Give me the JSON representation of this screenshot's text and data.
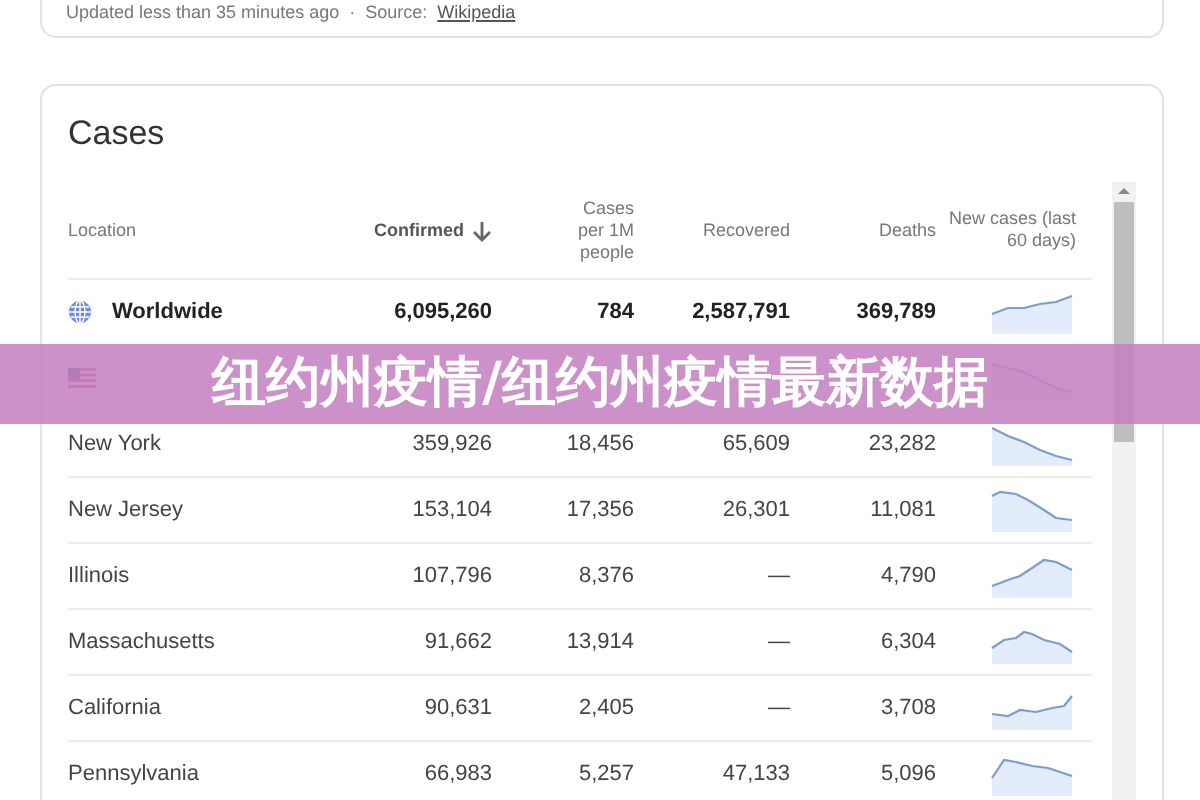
{
  "top_card": {
    "updated": "Updated less than 35 minutes ago",
    "separator": "·",
    "source_label": "Source:",
    "source_link": "Wikipedia"
  },
  "cases": {
    "title": "Cases",
    "columns": [
      {
        "label": "Location",
        "sorted": false
      },
      {
        "label": "Confirmed",
        "sorted": true
      },
      {
        "label": "Cases per 1M people",
        "sorted": false
      },
      {
        "label": "Recovered",
        "sorted": false
      },
      {
        "label": "Deaths",
        "sorted": false
      },
      {
        "label": "New cases (last 60 days)",
        "sorted": false
      }
    ],
    "rows": [
      {
        "kind": "globe",
        "location": "Worldwide",
        "confirmed": "6,095,260",
        "per_million": "784",
        "recovered": "2,587,791",
        "deaths": "369,789"
      },
      {
        "kind": "flag"
      },
      {
        "kind": "plain",
        "location": "New York",
        "confirmed": "359,926",
        "per_million": "18,456",
        "recovered": "65,609",
        "deaths": "23,282"
      },
      {
        "kind": "plain",
        "location": "New Jersey",
        "confirmed": "153,104",
        "per_million": "17,356",
        "recovered": "26,301",
        "deaths": "11,081"
      },
      {
        "kind": "plain",
        "location": "Illinois",
        "confirmed": "107,796",
        "per_million": "8,376",
        "recovered": "—",
        "deaths": "4,790"
      },
      {
        "kind": "plain",
        "location": "Massachusetts",
        "confirmed": "91,662",
        "per_million": "13,914",
        "recovered": "—",
        "deaths": "6,304"
      },
      {
        "kind": "plain",
        "location": "California",
        "confirmed": "90,631",
        "per_million": "2,405",
        "recovered": "—",
        "deaths": "3,708"
      },
      {
        "kind": "plain",
        "location": "Pennsylvania",
        "confirmed": "66,983",
        "per_million": "5,257",
        "recovered": "47,133",
        "deaths": "5,096"
      }
    ]
  },
  "banner": {
    "title": "纽约州疫情/纽约州疫情最新数据"
  }
}
